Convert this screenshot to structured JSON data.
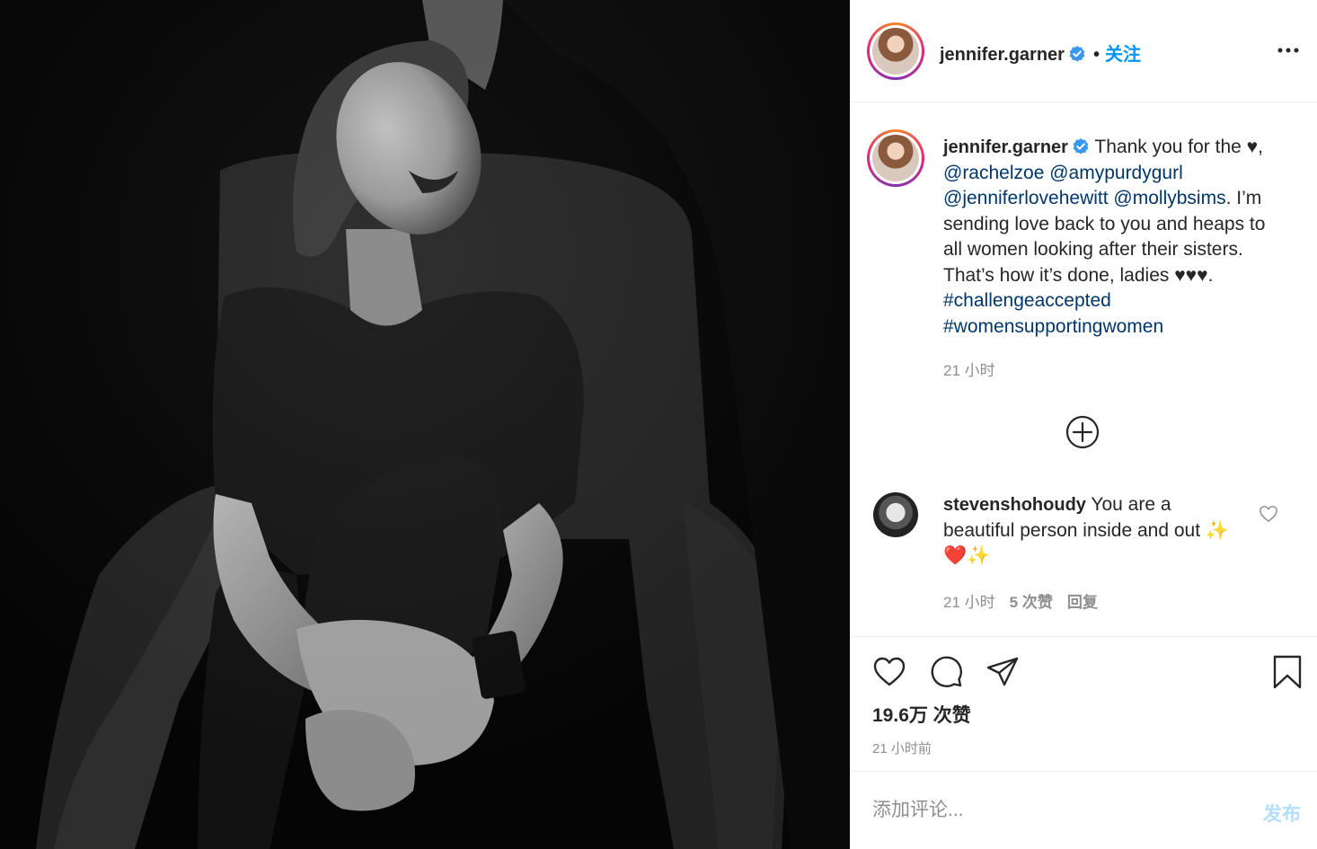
{
  "post": {
    "author": "jennifer.garner",
    "follow_label": "关注",
    "dot": "•",
    "caption": {
      "username": "jennifer.garner",
      "text_1": " Thank you for the ♥, ",
      "mentions": [
        "@rachelzoe",
        "@amypurdygurl",
        "@jenniferlovehewitt",
        "@mollybsims"
      ],
      "text_2": ". I’m sending love back to you and heaps to all women looking after their sisters. That’s how it’s done, ladies ♥♥♥. ",
      "hashtags": [
        "#challengeaccepted",
        "#womensupportingwomen"
      ],
      "time": "21 小时"
    },
    "comment": {
      "username": "stevenshohoudy",
      "text": " You are a beautiful person inside and out ",
      "emoji": "✨❤️✨",
      "time": "21 小时",
      "likes": "5 次赞",
      "reply": "回复"
    },
    "likes_label": "19.6万 次赞",
    "time_ago": "21 小时前",
    "add_comment_placeholder": "添加评论...",
    "post_button": "发布"
  },
  "colors": {
    "link": "#00376b",
    "follow": "#0095f6",
    "muted": "#8e8e8e",
    "post_disabled": "#b2dffc",
    "verified": "#3897f0"
  },
  "icons": [
    "verified-icon",
    "more-icon",
    "load-more-icon",
    "heart-icon",
    "comment-icon",
    "share-icon",
    "bookmark-icon"
  ]
}
